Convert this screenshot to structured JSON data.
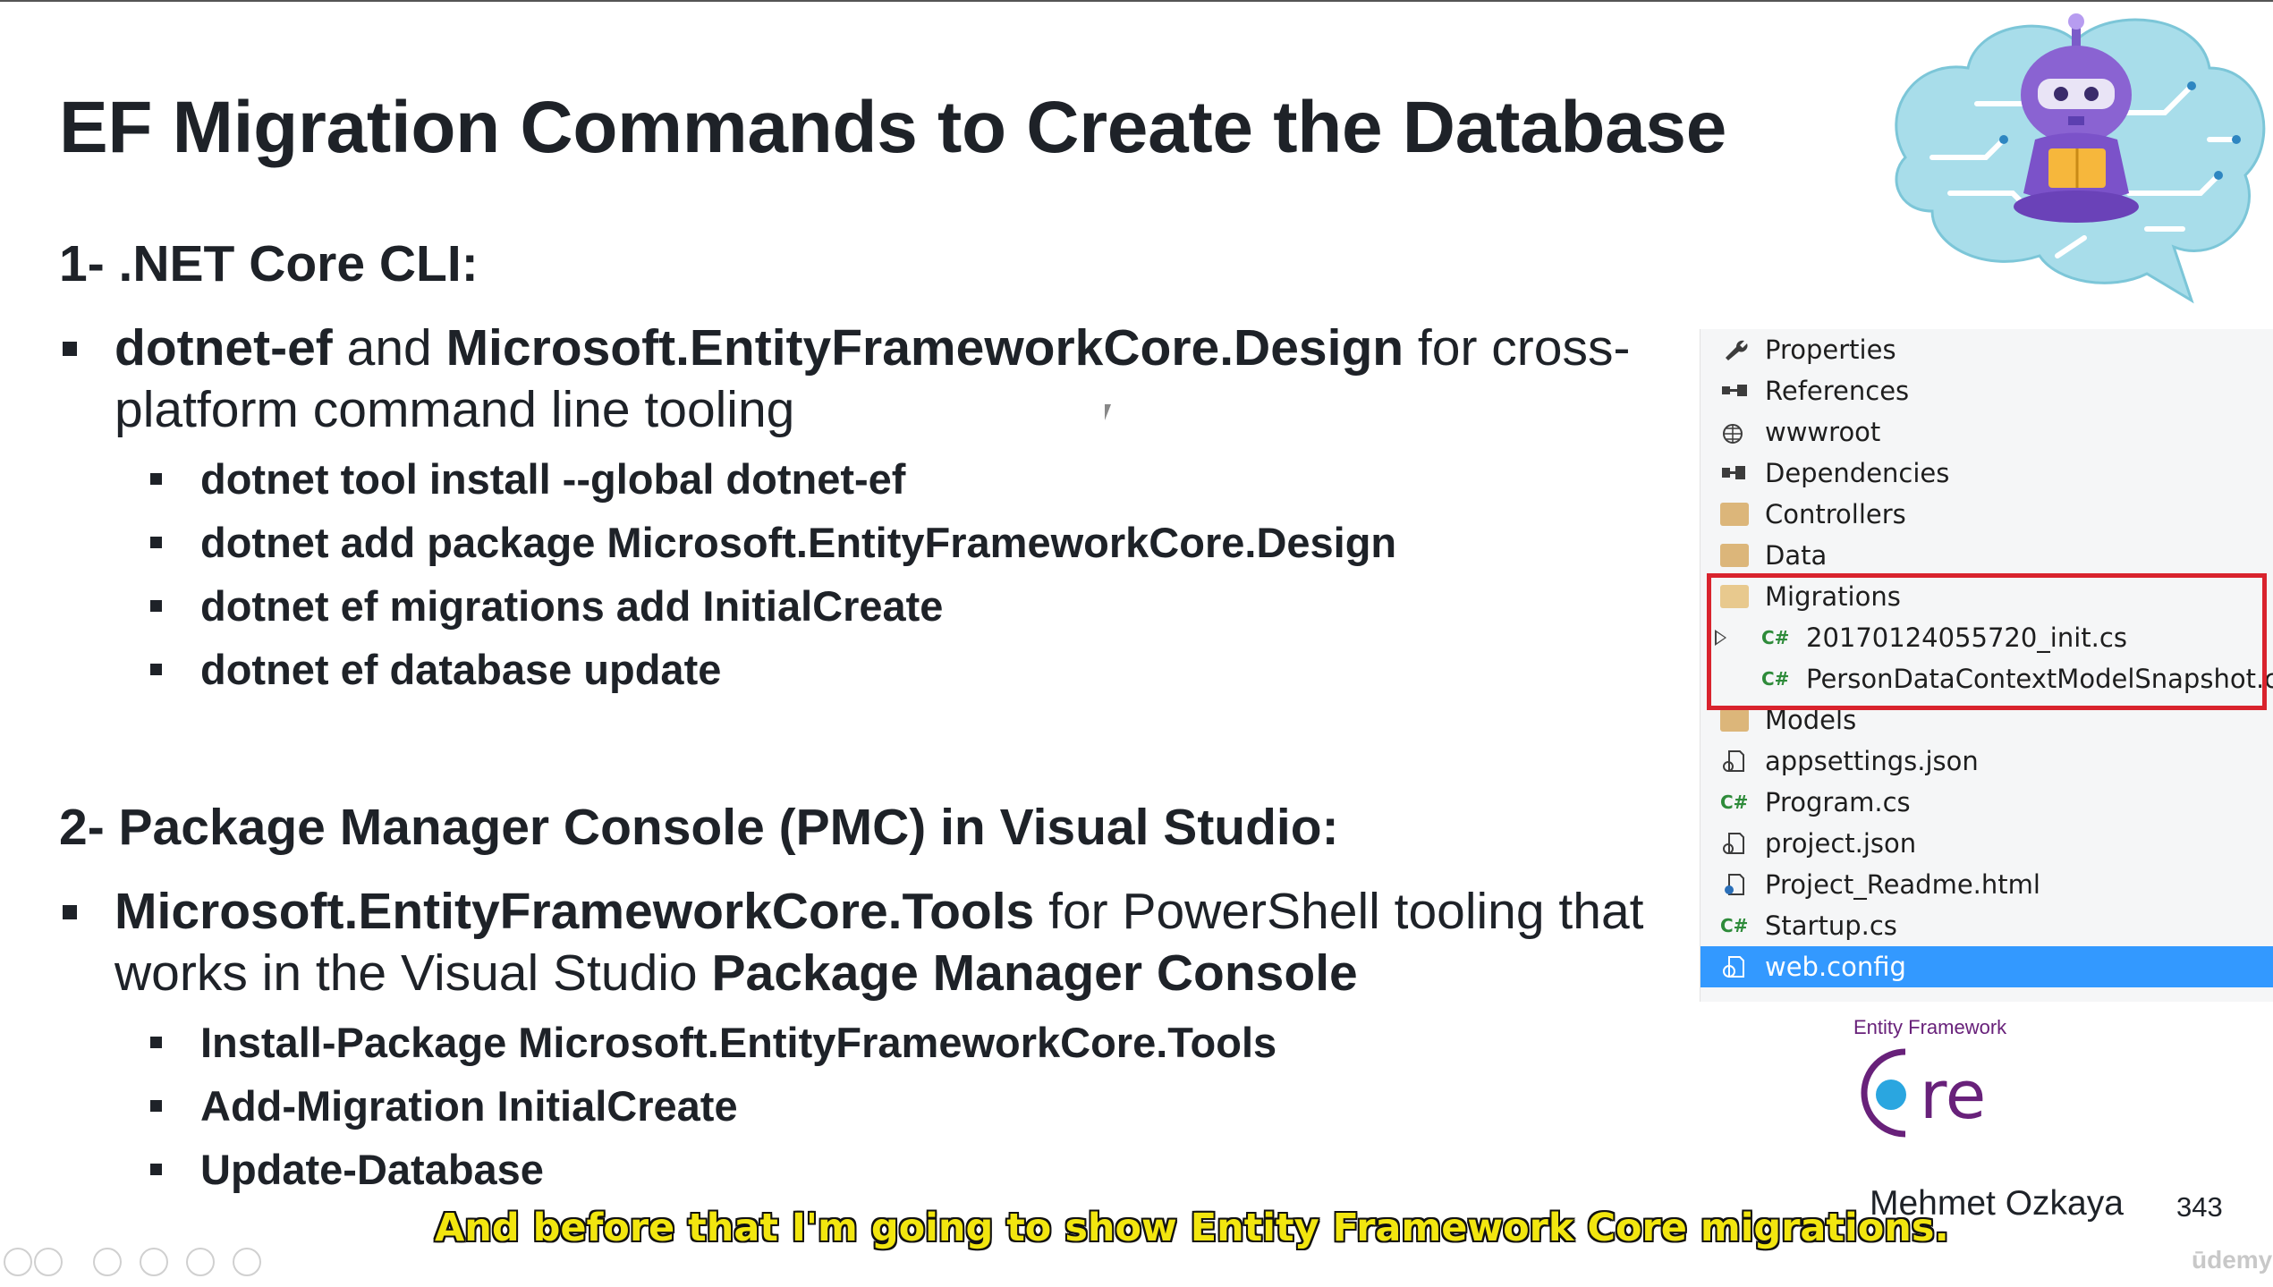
{
  "slide": {
    "title": "EF Migration Commands to Create the Database",
    "section1": {
      "heading": "1- .NET Core CLI:",
      "bullet_bold1": "dotnet-ef",
      "bullet_mid": " and ",
      "bullet_bold2": "Microsoft.EntityFrameworkCore.Design",
      "bullet_tail": " for cross-",
      "bullet_line2": "platform command line tooling",
      "commands": [
        "dotnet tool install --global dotnet-ef",
        "dotnet add package Microsoft.EntityFrameworkCore.Design",
        "dotnet ef migrations add InitialCreate",
        "dotnet ef database update"
      ]
    },
    "section2": {
      "heading": "2- Package Manager Console (PMC) in Visual Studio:",
      "bullet_bold1": "Microsoft.EntityFrameworkCore.Tools",
      "bullet_tail": " for PowerShell tooling that",
      "bullet_line2_plain": "works in the Visual Studio ",
      "bullet_line2_bold": "Package Manager Console",
      "commands": [
        "Install-Package Microsoft.EntityFrameworkCore.Tools",
        "Add-Migration InitialCreate",
        "Update-Database"
      ]
    },
    "author": "Mehmet Ozkaya",
    "page_number": "343",
    "ef_logo_small": "Entity Framework",
    "ef_logo_text": "re"
  },
  "explorer": {
    "items": [
      {
        "label": "Properties",
        "icon": "wrench-icon"
      },
      {
        "label": "References",
        "icon": "references-icon"
      },
      {
        "label": "wwwroot",
        "icon": "globe-icon"
      },
      {
        "label": "Dependencies",
        "icon": "dependencies-icon"
      },
      {
        "label": "Controllers",
        "icon": "folder-icon"
      },
      {
        "label": "Data",
        "icon": "folder-icon"
      },
      {
        "label": "Migrations",
        "icon": "folder-open-icon"
      },
      {
        "label": "20170124055720_init.cs",
        "icon": "csharp-file-icon"
      },
      {
        "label": "PersonDataContextModelSnapshot.cs",
        "icon": "csharp-file-icon"
      },
      {
        "label": "Models",
        "icon": "folder-icon"
      },
      {
        "label": "appsettings.json",
        "icon": "json-file-icon"
      },
      {
        "label": "Program.cs",
        "icon": "csharp-file-icon"
      },
      {
        "label": "project.json",
        "icon": "json-file-icon"
      },
      {
        "label": "Project_Readme.html",
        "icon": "html-file-icon"
      },
      {
        "label": "Startup.cs",
        "icon": "csharp-file-icon"
      },
      {
        "label": "web.config",
        "icon": "config-file-icon"
      }
    ],
    "cs_glyph": "C#"
  },
  "caption": "And before that I'm going to show Entity Framework Core migrations.",
  "watermark": "ūdemy",
  "colors": {
    "highlight_border": "#d9232d",
    "selected_row": "#3399ff",
    "caption_text": "#f2e60f",
    "ef_purple": "#68217a",
    "ef_blue": "#2aa6e0"
  }
}
